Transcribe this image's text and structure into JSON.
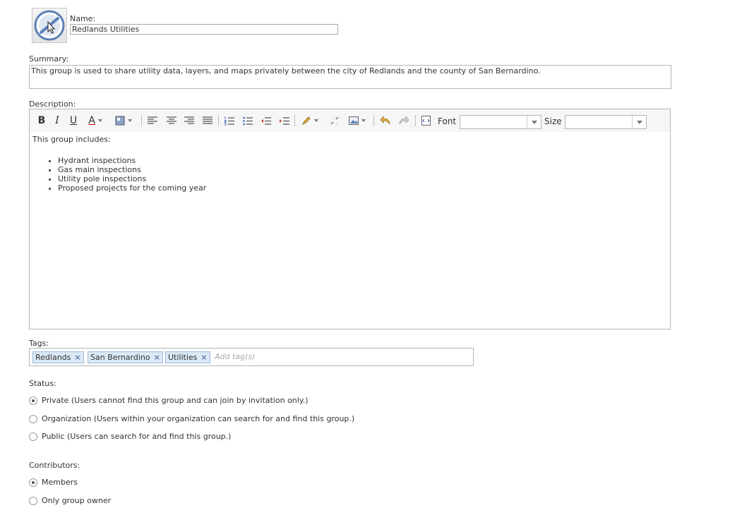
{
  "name": {
    "label": "Name:",
    "value": "Redlands Utilities"
  },
  "thumbnail": {
    "icon": "no-symbol-icon"
  },
  "summary": {
    "label": "Summary:",
    "value": "This group is used to share utility data, layers, and maps privately between the city of Redlands and the county of San Bernardino."
  },
  "description": {
    "label": "Description:",
    "toolbar": {
      "bold": "B",
      "italic": "I",
      "underline": "U",
      "font_color": "A",
      "font_label": "Font",
      "size_label": "Size",
      "font_value": "",
      "size_value": ""
    },
    "intro": "This group includes:",
    "items": [
      "Hydrant inspections",
      "Gas main inspections",
      "Utility pole inspections",
      "Proposed projects for the coming year"
    ]
  },
  "tags": {
    "label": "Tags:",
    "items": [
      "Redlands",
      "San Bernardino",
      "Utilities"
    ],
    "remove_glyph": "×",
    "placeholder": "Add tag(s)"
  },
  "status": {
    "label": "Status:",
    "options": [
      {
        "text": "Private (Users cannot find this group and can join by invitation only.)",
        "selected": true
      },
      {
        "text": "Organization (Users within your organization can search for and find this group.)",
        "selected": false
      },
      {
        "text": "Public (Users can search for and find this group.)",
        "selected": false
      }
    ]
  },
  "contributors": {
    "label": "Contributors:",
    "options": [
      {
        "text": "Members",
        "selected": true
      },
      {
        "text": "Only group owner",
        "selected": false
      }
    ]
  },
  "colors": {
    "tag_bg": "#dbe8f5",
    "tag_border": "#9fbbd6",
    "icon_blue": "#5b7fb8"
  }
}
